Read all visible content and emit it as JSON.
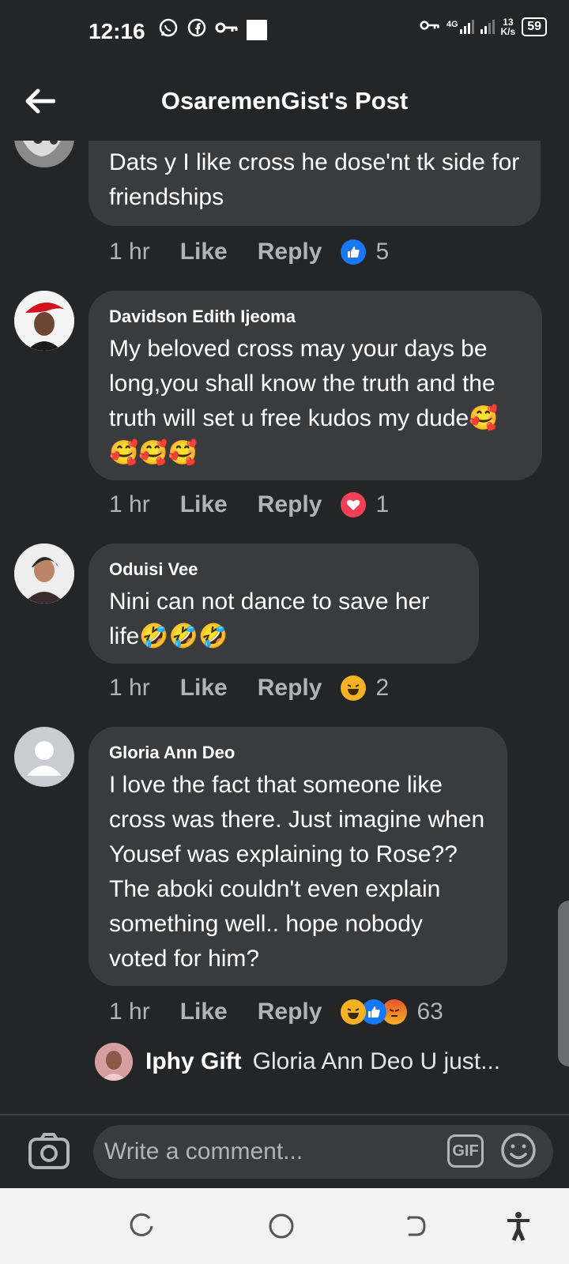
{
  "status": {
    "time": "12:16",
    "network": "4G",
    "speed_value": "13",
    "speed_unit": "K/s",
    "battery": "59"
  },
  "header": {
    "title": "OsaremenGist's Post"
  },
  "comments": [
    {
      "author": "",
      "text": "Dats y I like cross he dose'nt tk side for friendships",
      "time": "1 hr",
      "like_label": "Like",
      "reply_label": "Reply",
      "reaction_count": "5",
      "reaction_icons": [
        "like-icon"
      ]
    },
    {
      "author": "Davidson Edith Ijeoma",
      "text": "My beloved cross may your days be long,you shall know the truth and the truth will set u free kudos my dude🥰🥰🥰🥰",
      "time": "1 hr",
      "like_label": "Like",
      "reply_label": "Reply",
      "reaction_count": "1",
      "reaction_icons": [
        "love-icon"
      ]
    },
    {
      "author": "Oduisi Vee",
      "text": "Nini can not dance to save her life🤣🤣🤣",
      "time": "1 hr",
      "like_label": "Like",
      "reply_label": "Reply",
      "reaction_count": "2",
      "reaction_icons": [
        "haha-icon"
      ]
    },
    {
      "author": "Gloria Ann Deo",
      "text": "I love the fact that someone like cross was there. Just imagine when Yousef was explaining to Rose?? The aboki couldn't even explain something well.. hope nobody voted for him?",
      "time": "1 hr",
      "like_label": "Like",
      "reply_label": "Reply",
      "reaction_count": "63",
      "reaction_icons": [
        "haha-icon",
        "like-icon",
        "angry-icon"
      ]
    }
  ],
  "reply_preview": {
    "name": "Iphy Gift",
    "text": "Gloria Ann Deo U just..."
  },
  "composer": {
    "placeholder": "Write a comment...",
    "gif_label": "GIF"
  },
  "colors": {
    "background": "#242526",
    "bubble": "#3a3b3c",
    "like_blue": "#1877f2",
    "love_red": "#f33e58",
    "haha_yellow": "#f7b125"
  }
}
